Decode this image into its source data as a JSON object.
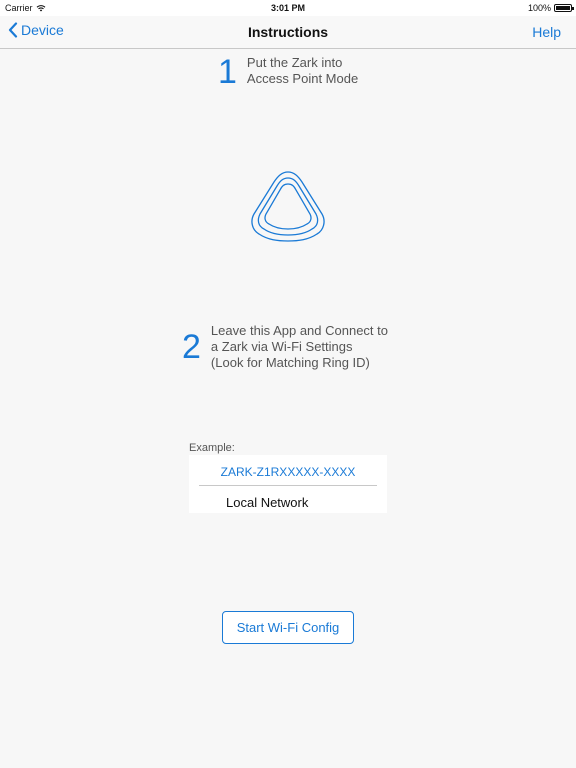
{
  "status_bar": {
    "carrier": "Carrier",
    "time": "3:01 PM",
    "battery": "100%"
  },
  "nav": {
    "back_label": "Device",
    "title": "Instructions",
    "help_label": "Help"
  },
  "steps": [
    {
      "number": "1",
      "text": "Put the Zark into\nAccess Point Mode"
    },
    {
      "number": "2",
      "text": "Leave this App and Connect to\na Zark via Wi-Fi Settings\n(Look for Matching Ring ID)"
    }
  ],
  "example": {
    "label": "Example:",
    "ssid": "ZARK-Z1RXXXXX-XXXX",
    "network": "Local Network"
  },
  "start_button_label": "Start Wi-Fi Config",
  "colors": {
    "accent": "#1a7ad6",
    "background": "#f7f7f7"
  },
  "icons": {
    "back": "chevron-left-icon",
    "wifi": "wifi-icon",
    "battery": "battery-icon",
    "device": "zark-device-icon"
  }
}
